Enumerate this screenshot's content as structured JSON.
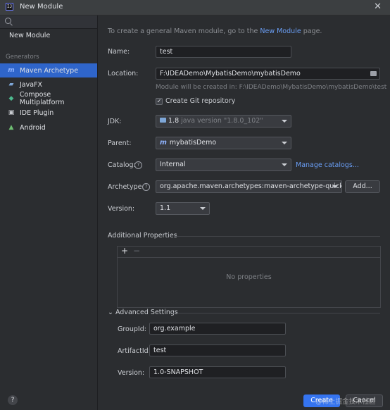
{
  "window": {
    "title": "New Module",
    "app_icon": "IJ"
  },
  "sidebar": {
    "new_module": "New Module",
    "generators_label": "Generators",
    "items": [
      {
        "label": "Maven Archetype",
        "icon": "m",
        "selected": true
      },
      {
        "label": "JavaFX",
        "icon": "javafx-icon"
      },
      {
        "label": "Compose Multiplatform",
        "icon": "compose-icon"
      },
      {
        "label": "IDE Plugin",
        "icon": "plugin-icon"
      },
      {
        "label": "Android",
        "icon": "android-icon"
      }
    ]
  },
  "form": {
    "intro_prefix": "To create a general Maven module, go to the ",
    "intro_link": "New Module",
    "intro_suffix": " page.",
    "name_label": "Name:",
    "name_value": "test",
    "location_label": "Location:",
    "location_value": "F:\\IDEADemo\\MybatisDemo\\mybatisDemo",
    "location_hint": "Module will be created in: F:\\IDEADemo\\MybatisDemo\\mybatisDemo\\test",
    "git_label": "Create Git repository",
    "git_checked": "✓",
    "jdk_label": "JDK:",
    "jdk_value": "1.8",
    "jdk_detail": "java version \"1.8.0_102\"",
    "parent_label": "Parent:",
    "parent_icon": "m",
    "parent_value": "mybatisDemo",
    "catalog_label": "Catalog:",
    "catalog_value": "Internal",
    "manage_catalogs": "Manage catalogs...",
    "archetype_label": "Archetype:",
    "archetype_value": "org.apache.maven.archetypes:maven-archetype-quickstart",
    "add_button": "Add...",
    "version_label": "Version:",
    "version_value": "1.1",
    "help_glyph": "?"
  },
  "additional": {
    "title": "Additional Properties",
    "plus": "+",
    "minus": "−",
    "empty": "No properties"
  },
  "advanced": {
    "title": "Advanced Settings",
    "chevron": "⌄",
    "groupid_label": "GroupId:",
    "groupid_value": "org.example",
    "artifactid_label": "ArtifactId:",
    "artifactid_value": "test",
    "version_label": "Version:",
    "version_value": "1.0-SNAPSHOT"
  },
  "footer": {
    "help": "?",
    "create": "Create",
    "cancel": "Cancel",
    "watermark": "@稀土掘金技术社区"
  },
  "colors": {
    "accent": "#3574f0",
    "selection": "#2f65ca",
    "link": "#6a9ef5"
  }
}
